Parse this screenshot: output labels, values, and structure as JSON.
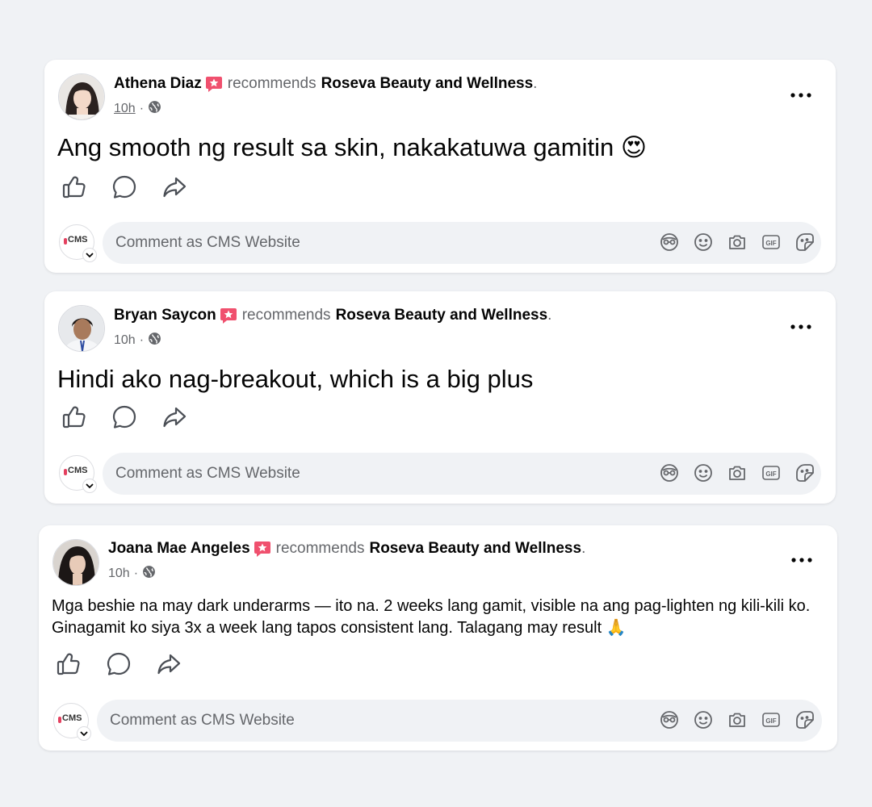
{
  "posts": [
    {
      "author": "Athena Diaz",
      "verb": "recommends",
      "page": "Roseva Beauty and Wellness",
      "period": ".",
      "time": "10h",
      "time_sep": "·",
      "text": "Ang smooth ng result sa skin, nakakatuwa gamitin 😍",
      "comment_placeholder": "Comment as CMS Website"
    },
    {
      "author": "Bryan Saycon",
      "verb": "recommends",
      "page": "Roseva Beauty and Wellness",
      "period": ".",
      "time": "10h",
      "time_sep": "·",
      "text": "Hindi ako nag-breakout, which is a big plus",
      "comment_placeholder": "Comment as CMS Website"
    },
    {
      "author": "Joana Mae Angeles",
      "verb": "recommends",
      "page": "Roseva Beauty and Wellness",
      "period": ".",
      "time": "10h",
      "time_sep": "·",
      "text": "Mga beshie na may dark underarms — ito na. 2 weeks lang gamit, visible na ang pag-lighten ng kili-kili ko. Ginagamit ko siya 3x a week lang tapos consistent lang. Talagang may result 🙏",
      "comment_placeholder": "Comment as CMS Website"
    }
  ],
  "commenter_avatar_text": "CMS",
  "icons": {
    "audience": "globe-icon",
    "badge": "recommend-star-icon",
    "more": "more-dots-icon",
    "like": "thumbs-up-icon",
    "comment": "comment-bubble-icon",
    "share": "share-arrow-icon",
    "avatar_sticker": "avatar-sticker-icon",
    "emoji": "emoji-icon",
    "camera": "camera-icon",
    "gif": "gif-icon",
    "sticker": "sticker-icon"
  },
  "colors": {
    "badge": "#f0506e",
    "icon_gray": "#65676b",
    "background": "#f0f2f5"
  }
}
